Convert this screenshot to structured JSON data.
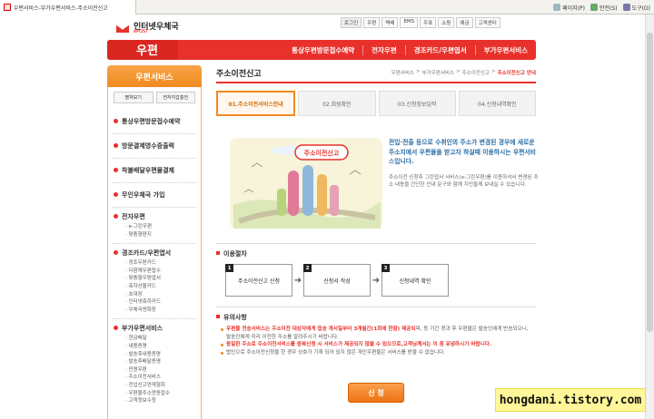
{
  "browser": {
    "tab_title": "우편서비스-부가우편서비스-주소이전신고",
    "tools": [
      "페이지(P)",
      "안전(S)",
      "도구(O)"
    ]
  },
  "header": {
    "brand": "인터넷우체국",
    "brand_sub": "ePOST",
    "logo_big": "우편",
    "util_nav": [
      "로그인",
      "우편",
      "택배",
      "EMS",
      "우표",
      "쇼핑",
      "예금",
      "고객센터"
    ],
    "main_nav": [
      "통상우편방문접수예약",
      "전자우편",
      "경조카드/우편엽서",
      "부가우편서비스"
    ]
  },
  "sidebar": {
    "title": "우편서비스",
    "tabs": [
      "펼쳐보기",
      "전자지갑충전"
    ],
    "items": [
      "통상우편방문접수예약",
      "방문결제영수증출력",
      "착불배달우편물결제",
      "무인우체국 가입"
    ],
    "groups": [
      {
        "title": "전자우편",
        "items": [
          "e-그린우편",
          "맞춤형편지"
        ]
      },
      {
        "title": "경조카드/우편엽서",
        "items": [
          "경조우편카드",
          "다함께우편접수",
          "맞춤형우편엽서",
          "축하선물카드",
          "초대장",
          "인터넷축하카드",
          "우체국엔화장"
        ]
      },
      {
        "title": "부가우편서비스",
        "items": [
          "현금배달",
          "내용증명",
          "발송후내용증명",
          "발송후배달증명",
          "민원우편",
          "주소이전서비스",
          "전입신고연계형회",
          "우편물주소연동접수",
          "고객정보수정"
        ]
      }
    ]
  },
  "content": {
    "page_title": "주소이전신고",
    "breadcrumb": [
      "우편서비스",
      ">",
      "부가우편서비스",
      ">",
      "주소이전신고",
      ">",
      "주소이전신고 안내"
    ],
    "steps": [
      "01.주소이전서비스안내",
      "02.회원확인",
      "03.신청정보입력",
      "04.신청내역확인"
    ],
    "illustration_label": "주소이전신고",
    "intro_main": "전입·전출 등으로 수취인의 주소가 변경된 경우에 새로운 주소지에서 우편물을 받고자 하실때 이용하시는 우편서비스입니다.",
    "intro_sub": "주소이전 신청후 그린엽서 서비스(e-그린우편)를 이용하셔서 변경된 주소 내용을 간단한 안내 문구와 함께 지인들께 보내실 수 있습니다.",
    "process_title": "이용절차",
    "process": [
      {
        "num": "1",
        "label": "주소이전신고 신청"
      },
      {
        "num": "2",
        "label": "신청서 작성"
      },
      {
        "num": "3",
        "label": "신청내역 확인"
      }
    ],
    "notes_title": "유의사항",
    "notes": [
      {
        "hl": "우편물 전송서비스는 주소이전 대상자에게 접송 계서일부터 3개월간(1회에 한함) 제공되",
        "rest": "며, 동 기간 경과 후 우편물은 발송인에게 반송되오니, 발송인에게 미리 이전한 주소를 알려주시기 바랍니다."
      },
      {
        "hl": "동일한 주소로 주소이전서비스를 중복신청 시 서비스가 제공되지 않을 수 있으므로,고객님께서는 이 점 유념하시기 바랍니다.",
        "rest": ""
      },
      {
        "hl": "",
        "rest": "법인으로 주소이전신청을 한 경우 상호가 기재 되어 있지 않은 개인우편물은 서비스를 받을 수 없습니다."
      }
    ],
    "apply_button": "신 청"
  },
  "watermark": "hongdani.tistory.com",
  "colors": {
    "accent": "#e8312a",
    "orange": "#f08a1f",
    "link_blue": "#2a6fa8"
  }
}
